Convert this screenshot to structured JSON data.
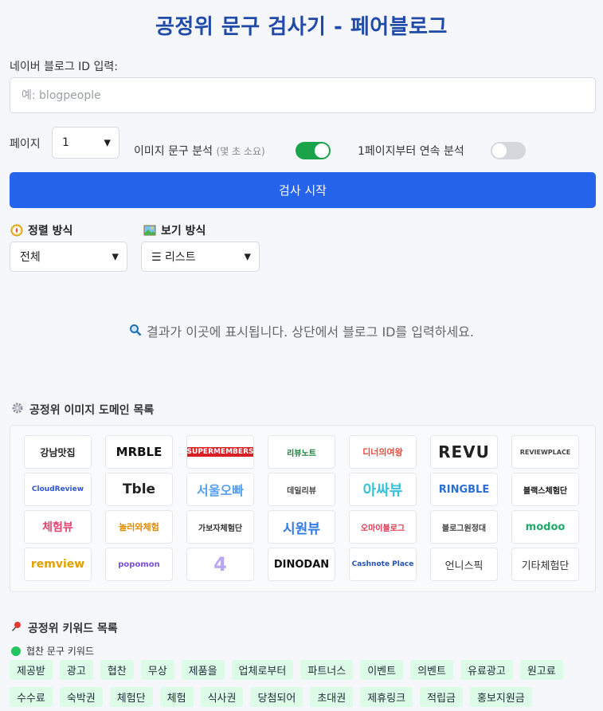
{
  "title": "공정위 문구 검사기 - 페어블로그",
  "id_input": {
    "label": "네이버 블로그 ID 입력:",
    "placeholder": "예: blogpeople",
    "value": ""
  },
  "page": {
    "label": "페이지",
    "selected": "1"
  },
  "image_analysis": {
    "label": "이미지 문구 분석",
    "hint": "(몇 초 소요)",
    "on": true
  },
  "continuous": {
    "label": "1페이지부터 연속 분석",
    "on": false
  },
  "start_button": "검사 시작",
  "sort": {
    "label": "정렬 방식",
    "icon": "compass-icon",
    "selected": "전체"
  },
  "view": {
    "label": "보기 방식",
    "icon": "picture-icon",
    "selected": "☰ 리스트"
  },
  "result_message": "결과가 이곳에 표시됩니다. 상단에서 블로그 ID를 입력하세요.",
  "domain_section": {
    "title": "공정위 이미지 도메인 목록",
    "logos": [
      "강남맛집",
      "MRBLE",
      "SUPERMEMBERS",
      "리뷰노트",
      "디너의여왕",
      "REVU",
      "REVIEWPLACE",
      "CloudReview",
      "Tble",
      "서울오빠",
      "데일리뷰",
      "아싸뷰",
      "RINGBLE",
      "블랙스체험단",
      "체험뷰",
      "놀러와체험",
      "가보자체험단",
      "시원뷰",
      "오마이블로그",
      "블로그원정대",
      "modoo",
      "remview",
      "popomon",
      "4",
      "DINODAN",
      "Cashnote Place",
      "언니스픽",
      "기타체험단"
    ]
  },
  "keyword_section": {
    "title": "공정위 키워드 목록",
    "sub_label": "협찬 문구 키워드",
    "row1": [
      "제공받",
      "광고",
      "협찬",
      "무상",
      "제품을",
      "업체로부터",
      "파트너스",
      "이벤트",
      "의벤트",
      "유료광고",
      "원고료"
    ],
    "row2": [
      "수수료",
      "숙박권",
      "체험단",
      "체험",
      "식사권",
      "당첨되어",
      "초대권",
      "제휴링크",
      "적립금",
      "홍보지원금"
    ]
  },
  "colors": {
    "accent": "#2563eb",
    "title": "#1f4aa8",
    "toggle_on": "#1aa34a",
    "chip": "#dcfce7"
  }
}
